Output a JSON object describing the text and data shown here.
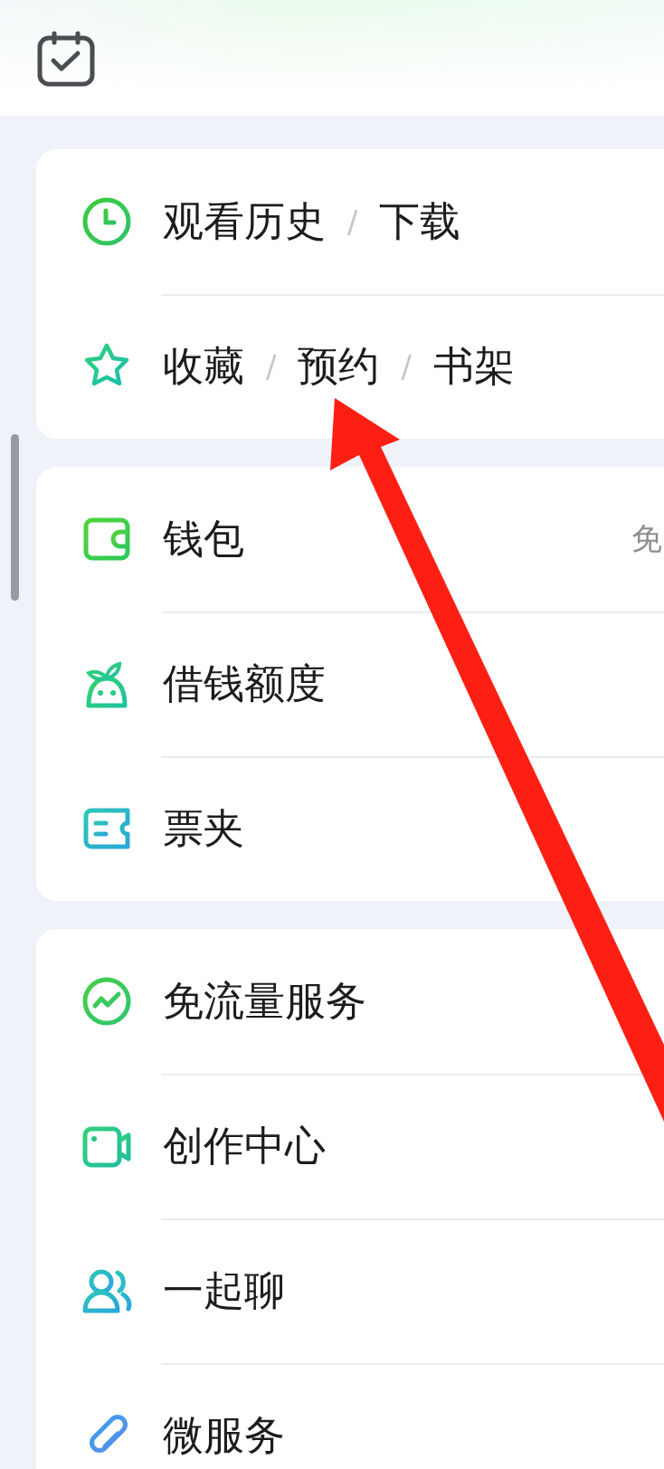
{
  "header": {
    "kind": "calendar"
  },
  "sections": [
    {
      "rows": [
        {
          "labels": [
            "观看历史",
            "下载"
          ],
          "separator": "/"
        },
        {
          "labels": [
            "收藏",
            "预约",
            "书架"
          ],
          "separator": "/"
        }
      ]
    },
    {
      "rows": [
        {
          "labels": [
            "钱包"
          ],
          "trailing": "免"
        },
        {
          "labels": [
            "借钱额度"
          ]
        },
        {
          "labels": [
            "票夹"
          ]
        }
      ]
    },
    {
      "rows": [
        {
          "labels": [
            "免流量服务"
          ]
        },
        {
          "labels": [
            "创作中心"
          ]
        },
        {
          "labels": [
            "一起聊"
          ]
        },
        {
          "labels": [
            "微服务"
          ]
        }
      ]
    }
  ],
  "annotation": {
    "kind": "arrow"
  }
}
